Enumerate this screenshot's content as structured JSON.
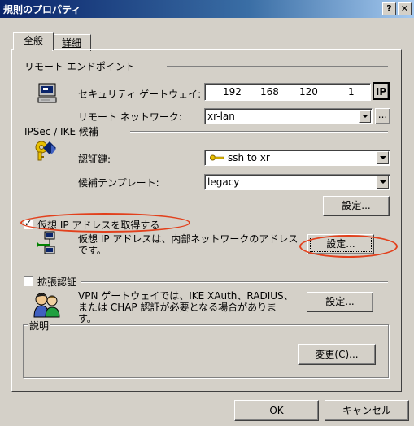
{
  "window": {
    "title": "規則のプロパティ",
    "help_glyph": "?",
    "close_glyph": "✕"
  },
  "tabs": [
    {
      "label": "全般",
      "active": true
    },
    {
      "label": "詳細",
      "active": false
    }
  ],
  "remote_endpoint": {
    "section_label": "リモート エンドポイント",
    "gateway_label": "セキュリティ ゲートウェイ:",
    "ip_octets": [
      "192",
      "168",
      "120",
      "1"
    ],
    "ip_button": "IP",
    "network_label": "リモート ネットワーク:",
    "network_value": "xr-lan",
    "network_more": "..."
  },
  "ipsec": {
    "section_label": "IPSec / IKE 候補",
    "auth_key_label": "認証鍵:",
    "auth_key_value": "ssh to xr",
    "template_label": "候補テンプレート:",
    "template_value": "legacy",
    "settings_button": "設定..."
  },
  "virtual_ip": {
    "checkbox_label": "仮想 IP アドレスを取得する",
    "checked": true,
    "description_line1": "仮想 IP アドレスは、内部ネットワークのアドレス",
    "description_line2": "です。",
    "settings_button": "設定..."
  },
  "extended_auth": {
    "checkbox_label": "拡張認証",
    "checked": false,
    "description_line1": "VPN ゲートウェイでは、IKE XAuth、RADIUS、",
    "description_line2": "または CHAP 認証が必要となる場合がありま",
    "description_line3": "す。",
    "settings_button": "設定..."
  },
  "description_group": {
    "label": "説明",
    "change_button": "変更(C)..."
  },
  "footer": {
    "ok_button": "OK",
    "cancel_button": "キャンセル"
  },
  "colors": {
    "titlebar_start": "#0a246a",
    "dialog_face": "#d4d0c8",
    "annotation_oval": "#e2401c"
  }
}
